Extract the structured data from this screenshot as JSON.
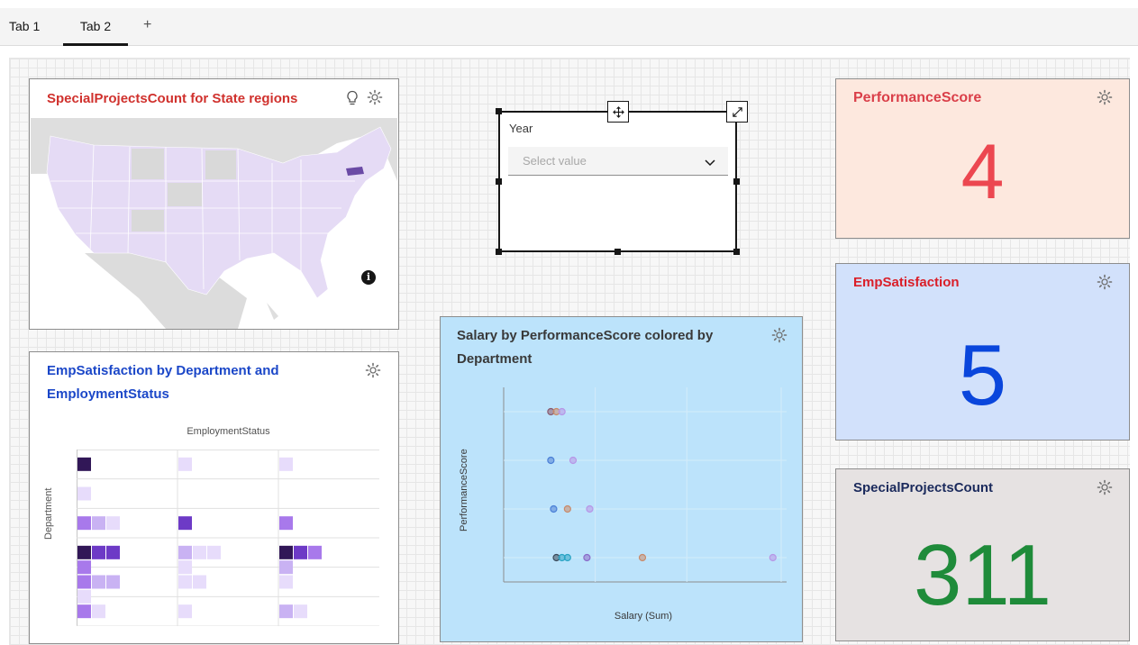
{
  "tabs": [
    {
      "label": "Tab 1"
    },
    {
      "label": "Tab 2",
      "active": true
    }
  ],
  "add_tab_label": "+",
  "map_widget": {
    "title": "SpecialProjectsCount for State regions",
    "highlight_color": "#6a4aa5",
    "region_color": "#e5dbf5"
  },
  "filter_widget": {
    "label": "Year",
    "placeholder": "Select value"
  },
  "kpis": {
    "performance": {
      "title": "PerformanceScore",
      "value": "4"
    },
    "satisfaction": {
      "title": "EmpSatisfaction",
      "value": "5"
    },
    "projects": {
      "title": "SpecialProjectsCount",
      "value": "311"
    }
  },
  "heatmap_widget": {
    "title": "EmpSatisfaction by Department and EmploymentStatus",
    "x_axis_label": "EmploymentStatus",
    "y_axis_label": "Department"
  },
  "scatter_widget": {
    "title": "Salary by PerformanceScore colored by Department",
    "x_axis_label": "Salary (Sum)",
    "y_axis_label": "PerformanceScore"
  },
  "chart_data": [
    {
      "type": "heatmap",
      "title": "EmpSatisfaction by Department and EmploymentStatus",
      "xlabel": "EmploymentStatus",
      "ylabel": "Department",
      "columns": 3,
      "rows": 6,
      "cells": [
        {
          "col": 0,
          "row": 0,
          "sub": 0,
          "level": 5
        },
        {
          "col": 1,
          "row": 0,
          "sub": 0,
          "level": 1
        },
        {
          "col": 2,
          "row": 0,
          "sub": 0,
          "level": 1
        },
        {
          "col": 0,
          "row": 1,
          "sub": 0,
          "level": 1
        },
        {
          "col": 0,
          "row": 2,
          "sub": 0,
          "level": 3
        },
        {
          "col": 0,
          "row": 2,
          "sub": 1,
          "level": 2
        },
        {
          "col": 0,
          "row": 2,
          "sub": 2,
          "level": 1
        },
        {
          "col": 1,
          "row": 2,
          "sub": 0,
          "level": 4
        },
        {
          "col": 2,
          "row": 2,
          "sub": 0,
          "level": 3
        },
        {
          "col": 0,
          "row": 3,
          "sub": 0,
          "level": 5
        },
        {
          "col": 0,
          "row": 3,
          "sub": 1,
          "level": 4
        },
        {
          "col": 0,
          "row": 3,
          "sub": 2,
          "level": 4
        },
        {
          "col": 1,
          "row": 3,
          "sub": 0,
          "level": 2
        },
        {
          "col": 1,
          "row": 3,
          "sub": 1,
          "level": 1
        },
        {
          "col": 1,
          "row": 3,
          "sub": 2,
          "level": 1
        },
        {
          "col": 2,
          "row": 3,
          "sub": 0,
          "level": 5
        },
        {
          "col": 2,
          "row": 3,
          "sub": 1,
          "level": 4
        },
        {
          "col": 2,
          "row": 3,
          "sub": 2,
          "level": 3
        },
        {
          "col": 0,
          "row": 3.5,
          "sub": 0,
          "level": 3
        },
        {
          "col": 1,
          "row": 3.5,
          "sub": 0,
          "level": 1
        },
        {
          "col": 2,
          "row": 3.5,
          "sub": 0,
          "level": 2
        },
        {
          "col": 0,
          "row": 4,
          "sub": 0,
          "level": 3
        },
        {
          "col": 0,
          "row": 4,
          "sub": 1,
          "level": 2
        },
        {
          "col": 0,
          "row": 4,
          "sub": 2,
          "level": 2
        },
        {
          "col": 1,
          "row": 4,
          "sub": 0,
          "level": 1
        },
        {
          "col": 1,
          "row": 4,
          "sub": 1,
          "level": 1
        },
        {
          "col": 2,
          "row": 4,
          "sub": 0,
          "level": 1
        },
        {
          "col": 0,
          "row": 4.5,
          "sub": 0,
          "level": 1
        },
        {
          "col": 0,
          "row": 5,
          "sub": 0,
          "level": 3
        },
        {
          "col": 0,
          "row": 5,
          "sub": 1,
          "level": 1
        },
        {
          "col": 1,
          "row": 5,
          "sub": 0,
          "level": 1
        },
        {
          "col": 2,
          "row": 5,
          "sub": 0,
          "level": 2
        },
        {
          "col": 2,
          "row": 5,
          "sub": 1,
          "level": 1
        }
      ]
    },
    {
      "type": "scatter",
      "title": "Salary by PerformanceScore colored by Department",
      "xlabel": "Salary (Sum)",
      "ylabel": "PerformanceScore",
      "points": [
        {
          "x": 0.17,
          "y": 4,
          "color": "#8a5a6e"
        },
        {
          "x": 0.19,
          "y": 4,
          "color": "#c98a6a"
        },
        {
          "x": 0.21,
          "y": 4,
          "color": "#b796e6"
        },
        {
          "x": 0.17,
          "y": 3,
          "color": "#4a7fd6"
        },
        {
          "x": 0.25,
          "y": 3,
          "color": "#b796e6"
        },
        {
          "x": 0.18,
          "y": 2,
          "color": "#4a7fd6"
        },
        {
          "x": 0.23,
          "y": 2,
          "color": "#c98a6a"
        },
        {
          "x": 0.31,
          "y": 2,
          "color": "#b796e6"
        },
        {
          "x": 0.19,
          "y": 1,
          "color": "#3a4a5a"
        },
        {
          "x": 0.21,
          "y": 1,
          "color": "#2aa4c4"
        },
        {
          "x": 0.23,
          "y": 1,
          "color": "#2aa4c4"
        },
        {
          "x": 0.3,
          "y": 1,
          "color": "#8a6ac8"
        },
        {
          "x": 0.5,
          "y": 1,
          "color": "#c98a6a"
        },
        {
          "x": 0.97,
          "y": 1,
          "color": "#b796e6"
        }
      ]
    }
  ]
}
